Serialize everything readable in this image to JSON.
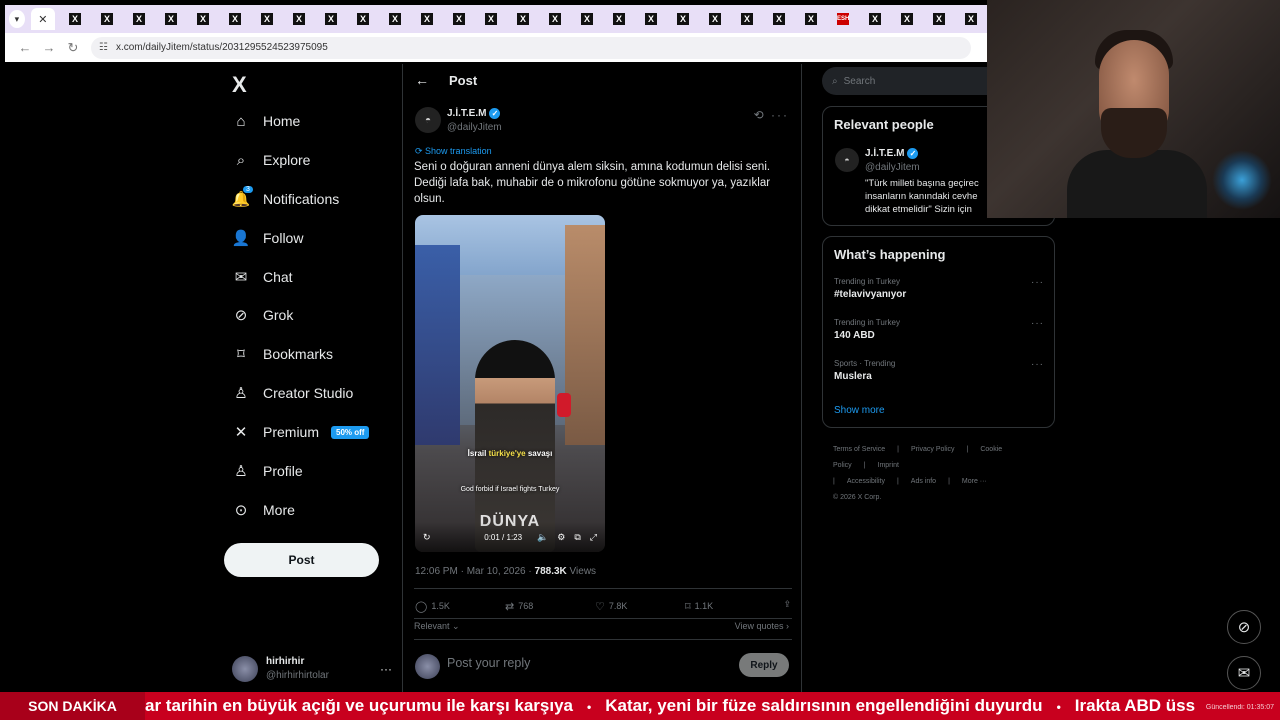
{
  "browser": {
    "url": "x.com/dailyJitem/status/2031295524523975095",
    "tab_letter": "X",
    "special_tab": "ESH"
  },
  "nav": {
    "logo": "X",
    "items": [
      {
        "label": "Home",
        "icon": "home-icon"
      },
      {
        "label": "Explore",
        "icon": "search-icon"
      },
      {
        "label": "Notifications",
        "icon": "bell-icon",
        "count": "3"
      },
      {
        "label": "Follow",
        "icon": "follow-icon"
      },
      {
        "label": "Chat",
        "icon": "mail-icon"
      },
      {
        "label": "Grok",
        "icon": "grok-icon"
      },
      {
        "label": "Bookmarks",
        "icon": "bookmark-icon"
      },
      {
        "label": "Creator Studio",
        "icon": "creator-icon"
      },
      {
        "label": "Premium",
        "icon": "x-icon",
        "badge": "50% off"
      },
      {
        "label": "Profile",
        "icon": "profile-icon"
      },
      {
        "label": "More",
        "icon": "more-circle-icon"
      }
    ],
    "post_button": "Post"
  },
  "account": {
    "name": "hirhirhir",
    "handle": "@hirhirhirtolar"
  },
  "post": {
    "header": "Post",
    "author_name": "J.İ.T.E.M",
    "author_handle": "@dailyJitem",
    "show_translation": "Show translation",
    "text": "Seni o doğuran anneni dünya alem siksin, amına kodumun delisi seni. Dediği lafa bak, muhabir de o mikrofonu götüne sokmuyor ya, yazıklar olsun.",
    "video": {
      "caption_pre": "İsrail ",
      "caption_highlight": "türkiye'ye",
      "caption_post": " savaşı",
      "caption_en": "God forbid if Israel fights Turkey",
      "watermark": "DÜNYA",
      "time": "0:01 / 1:23"
    },
    "timestamp": "12:06 PM · Mar 10, 2026 · ",
    "views_count": "788.3K",
    "views_label": " Views",
    "replies": "1.5K",
    "reposts": "768",
    "likes": "7.8K",
    "bookmarks": "1.1K",
    "relevant": "Relevant",
    "view_quotes": "View quotes",
    "reply_placeholder": "Post your reply",
    "reply_button": "Reply"
  },
  "sidebar": {
    "search_placeholder": "Search",
    "relevant_people_title": "Relevant people",
    "person_name": "J.İ.T.E.M",
    "person_handle": "@dailyJitem",
    "person_bio": "\"Türk milleti başına geçirec\ninsanların kanındaki cevhe\ndikkat etmelidir\" Sizin için",
    "happening_title": "What’s happening",
    "trends": [
      {
        "context": "Trending in Turkey",
        "topic": "#telavivyanıyor"
      },
      {
        "context": "Trending in Turkey",
        "topic": "140 ABD"
      },
      {
        "context": "Sports · Trending",
        "topic": "Muslera"
      }
    ],
    "show_more": "Show more",
    "footer": [
      "Terms of Service",
      "|",
      "Privacy Policy",
      "|",
      "Cookie Policy",
      "|",
      "Imprint",
      "|",
      "Accessibility",
      "|",
      "Ads info",
      "|",
      "More ···",
      "© 2026 X Corp."
    ]
  },
  "ticker": {
    "label": "SON DAKİKA",
    "items": [
      "ar tarihin en büyük açığı ve uçurumu ile karşı karşıya",
      "Katar, yeni bir füze saldırısının engellendiğini duyurdu",
      "Irakta ABD üss"
    ],
    "stamp": "Güncellendi: 01:35:07"
  },
  "colors": {
    "accent": "#1d9bf0",
    "background": "#000000",
    "ticker": "#c8001e",
    "tabbar": "#e8dff7"
  }
}
